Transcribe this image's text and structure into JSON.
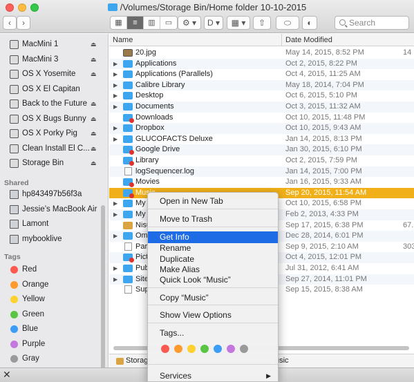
{
  "window": {
    "title": "/Volumes/Storage Bin/Home folder 10-10-2015",
    "search_placeholder": "Search"
  },
  "toolbar": {
    "back": "‹",
    "forward": "›",
    "view_icons": [
      "icon-view",
      "list-view",
      "column-view",
      "coverflow-view"
    ],
    "action": "⚙ ▾",
    "share": "⇧",
    "tag": "⬭",
    "arrange": "▦ ▾",
    "dropbox": "D ▾",
    "quicklook": "◐"
  },
  "sidebar": {
    "devices": [
      {
        "label": "MacMini 1",
        "eject": "⏏"
      },
      {
        "label": "MacMini 3",
        "eject": "⏏"
      },
      {
        "label": "OS X Yosemite",
        "eject": "⏏"
      },
      {
        "label": "OS X El Capitan",
        "eject": ""
      },
      {
        "label": "Back to the Future",
        "eject": "⏏"
      },
      {
        "label": "OS X Bugs Bunny",
        "eject": "⏏"
      },
      {
        "label": "OS X Porky Pig",
        "eject": "⏏"
      },
      {
        "label": "Clean Install El C...",
        "eject": "⏏"
      },
      {
        "label": "Storage Bin",
        "eject": "⏏"
      }
    ],
    "shared_header": "Shared",
    "shared": [
      {
        "label": "hp843497b56f3a"
      },
      {
        "label": "Jessie’s MacBook Air"
      },
      {
        "label": "Lamont"
      },
      {
        "label": "mybooklive"
      }
    ],
    "tags_header": "Tags",
    "tags": [
      {
        "label": "Red",
        "color": "#fc5a51"
      },
      {
        "label": "Orange",
        "color": "#fd9a2e"
      },
      {
        "label": "Yellow",
        "color": "#fdd12f"
      },
      {
        "label": "Green",
        "color": "#5ac544"
      },
      {
        "label": "Blue",
        "color": "#3c9cf6"
      },
      {
        "label": "Purple",
        "color": "#c477dd"
      },
      {
        "label": "Gray",
        "color": "#9a9a9a"
      }
    ]
  },
  "list": {
    "col_name": "Name",
    "col_date": "Date Modified",
    "rows": [
      {
        "name": "20.jpg",
        "date": "May 14, 2015, 8:52 PM",
        "size": "14",
        "kind": "image",
        "expand": false
      },
      {
        "name": "Applications",
        "date": "Oct 2, 2015, 8:22 PM",
        "size": "",
        "kind": "folder",
        "expand": true
      },
      {
        "name": "Applications (Parallels)",
        "date": "Oct 4, 2015, 11:25 AM",
        "size": "",
        "kind": "folder",
        "expand": true
      },
      {
        "name": "Calibre Library",
        "date": "May 18, 2014, 7:04 PM",
        "size": "",
        "kind": "folder",
        "expand": true
      },
      {
        "name": "Desktop",
        "date": "Oct 6, 2015, 5:10 PM",
        "size": "",
        "kind": "folder",
        "expand": true
      },
      {
        "name": "Documents",
        "date": "Oct 3, 2015, 11:32 AM",
        "size": "",
        "kind": "folder",
        "expand": true
      },
      {
        "name": "Downloads",
        "date": "Oct 10, 2015, 11:48 PM",
        "size": "",
        "kind": "folder-locked",
        "expand": false
      },
      {
        "name": "Dropbox",
        "date": "Oct 10, 2015, 9:43 AM",
        "size": "",
        "kind": "folder",
        "expand": true
      },
      {
        "name": "GLUCOFACTS Deluxe",
        "date": "Jan 14, 2015, 8:13 PM",
        "size": "",
        "kind": "folder",
        "expand": true
      },
      {
        "name": "Google Drive",
        "date": "Jan 30, 2015, 6:10 PM",
        "size": "",
        "kind": "folder-locked",
        "expand": false
      },
      {
        "name": "Library",
        "date": "Oct 2, 2015, 7:59 PM",
        "size": "",
        "kind": "folder-locked",
        "expand": false
      },
      {
        "name": "logSequencer.log",
        "date": "Jan 14, 2015, 7:00 PM",
        "size": "",
        "kind": "file",
        "expand": false
      },
      {
        "name": "Movies",
        "date": "Jan 16, 2015, 9:33 AM",
        "size": "",
        "kind": "folder-locked",
        "expand": false
      },
      {
        "name": "Music",
        "date": "Sep 20, 2015, 11:54 AM",
        "size": "",
        "kind": "folder-locked",
        "expand": false,
        "selected": true
      },
      {
        "name": "My",
        "date": "Oct 10, 2015, 6:58 PM",
        "size": "",
        "kind": "folder",
        "expand": true
      },
      {
        "name": "My",
        "date": "Feb 2, 2013, 4:33 PM",
        "size": "",
        "kind": "folder",
        "expand": true
      },
      {
        "name": "Nisu",
        "date": "Sep 17, 2015, 6:38 PM",
        "size": "67.",
        "kind": "pkg",
        "expand": false
      },
      {
        "name": "Om",
        "date": "Dec 28, 2014, 6:01 PM",
        "size": "",
        "kind": "folder",
        "expand": true
      },
      {
        "name": "Para",
        "date": "Sep 9, 2015, 2:10 AM",
        "size": "303.",
        "kind": "file",
        "expand": false
      },
      {
        "name": "Pict",
        "date": "Oct 4, 2015, 12:01 PM",
        "size": "",
        "kind": "folder-locked",
        "expand": false
      },
      {
        "name": "Pub",
        "date": "Jul 31, 2012, 6:41 AM",
        "size": "",
        "kind": "folder",
        "expand": true
      },
      {
        "name": "Site",
        "date": "Sep 27, 2014, 11:01 PM",
        "size": "",
        "kind": "folder",
        "expand": true
      },
      {
        "name": "Sup",
        "date": "Sep 15, 2015, 8:38 AM",
        "size": "",
        "kind": "file",
        "expand": false
      }
    ]
  },
  "pathbar": {
    "left": "Storage",
    "right": "usic"
  },
  "bottombar": {
    "close": "✕"
  },
  "context_menu": {
    "items": [
      {
        "label": "Open in New Tab"
      },
      {
        "label": "Move to Trash"
      },
      {
        "label": "Get Info",
        "highlighted": true
      },
      {
        "label": "Rename"
      },
      {
        "label": "Duplicate"
      },
      {
        "label": "Make Alias"
      },
      {
        "label": "Quick Look “Music”"
      },
      {
        "label": "Copy “Music”"
      },
      {
        "label": "Show View Options"
      },
      {
        "label": "Tags..."
      },
      {
        "label": "Services"
      }
    ],
    "submenu_arrow": "▶",
    "tag_colors": [
      "#fc5a51",
      "#fd9a2e",
      "#fdd12f",
      "#5ac544",
      "#3c9cf6",
      "#c477dd",
      "#9a9a9a"
    ]
  }
}
